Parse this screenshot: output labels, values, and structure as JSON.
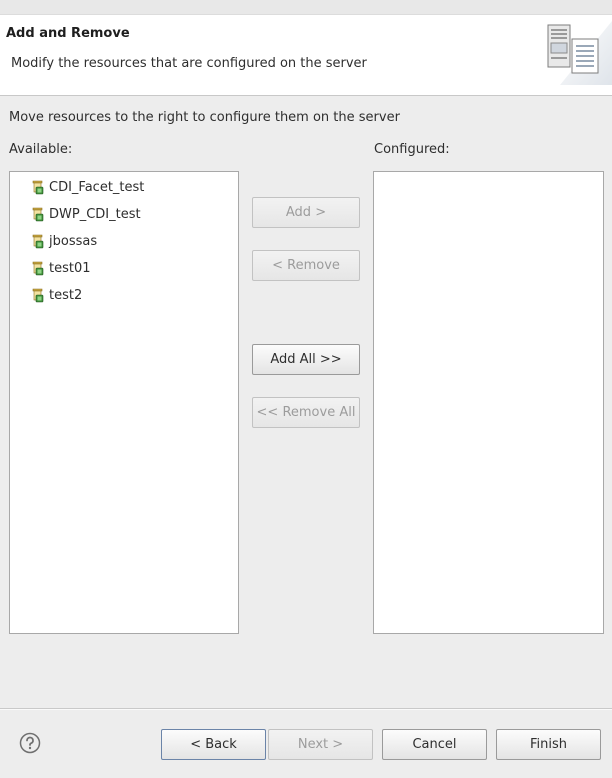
{
  "banner": {
    "title": "Add and Remove",
    "description": "Modify the resources that are configured on the server",
    "icon": "server-wizard-icon"
  },
  "instruction": "Move resources to the right to configure them on the server",
  "available": {
    "label": "Available:",
    "items": [
      {
        "label": "CDI_Facet_test",
        "icon": "project-icon"
      },
      {
        "label": "DWP_CDI_test",
        "icon": "project-icon"
      },
      {
        "label": "jbossas",
        "icon": "project-icon"
      },
      {
        "label": "test01",
        "icon": "project-icon"
      },
      {
        "label": "test2",
        "icon": "project-icon"
      }
    ]
  },
  "configured": {
    "label": "Configured:",
    "items": []
  },
  "transfer_buttons": {
    "add": "Add >",
    "remove": "< Remove",
    "add_all": "Add All >>",
    "remove_all": "<< Remove All"
  },
  "footer": {
    "help_icon": "help-icon",
    "back": "< Back",
    "next": "Next >",
    "cancel": "Cancel",
    "finish": "Finish"
  }
}
